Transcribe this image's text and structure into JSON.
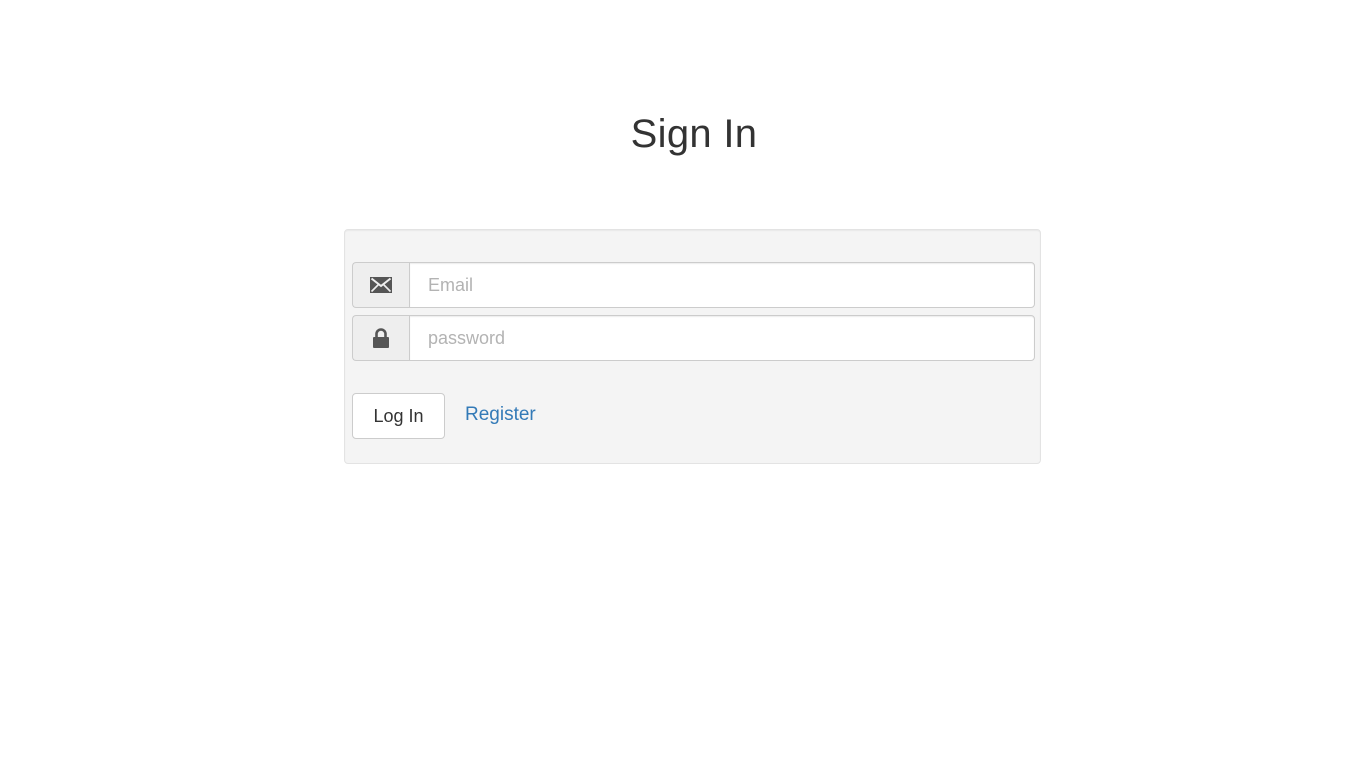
{
  "page": {
    "title": "Sign In"
  },
  "form": {
    "email": {
      "placeholder": "Email",
      "value": "",
      "icon": "envelope-icon"
    },
    "password": {
      "placeholder": "password",
      "value": "",
      "icon": "lock-icon"
    },
    "login_label": "Log In",
    "register_label": "Register"
  },
  "colors": {
    "link": "#337ab7",
    "panel_background": "#f4f4f4",
    "text": "#333333"
  }
}
